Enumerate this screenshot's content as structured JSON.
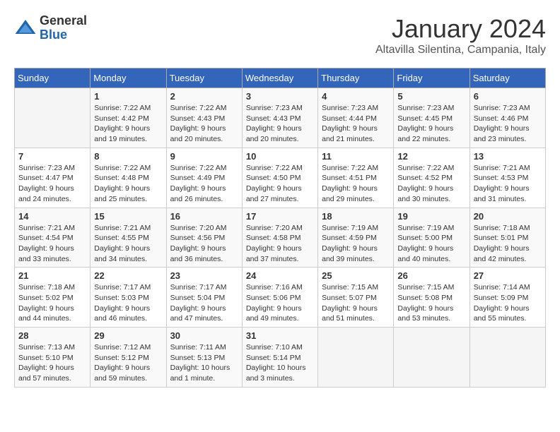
{
  "logo": {
    "general": "General",
    "blue": "Blue"
  },
  "header": {
    "month": "January 2024",
    "location": "Altavilla Silentina, Campania, Italy"
  },
  "weekdays": [
    "Sunday",
    "Monday",
    "Tuesday",
    "Wednesday",
    "Thursday",
    "Friday",
    "Saturday"
  ],
  "weeks": [
    [
      {
        "day": "",
        "info": ""
      },
      {
        "day": "1",
        "info": "Sunrise: 7:22 AM\nSunset: 4:42 PM\nDaylight: 9 hours\nand 19 minutes."
      },
      {
        "day": "2",
        "info": "Sunrise: 7:22 AM\nSunset: 4:43 PM\nDaylight: 9 hours\nand 20 minutes."
      },
      {
        "day": "3",
        "info": "Sunrise: 7:23 AM\nSunset: 4:43 PM\nDaylight: 9 hours\nand 20 minutes."
      },
      {
        "day": "4",
        "info": "Sunrise: 7:23 AM\nSunset: 4:44 PM\nDaylight: 9 hours\nand 21 minutes."
      },
      {
        "day": "5",
        "info": "Sunrise: 7:23 AM\nSunset: 4:45 PM\nDaylight: 9 hours\nand 22 minutes."
      },
      {
        "day": "6",
        "info": "Sunrise: 7:23 AM\nSunset: 4:46 PM\nDaylight: 9 hours\nand 23 minutes."
      }
    ],
    [
      {
        "day": "7",
        "info": "Sunrise: 7:23 AM\nSunset: 4:47 PM\nDaylight: 9 hours\nand 24 minutes."
      },
      {
        "day": "8",
        "info": "Sunrise: 7:22 AM\nSunset: 4:48 PM\nDaylight: 9 hours\nand 25 minutes."
      },
      {
        "day": "9",
        "info": "Sunrise: 7:22 AM\nSunset: 4:49 PM\nDaylight: 9 hours\nand 26 minutes."
      },
      {
        "day": "10",
        "info": "Sunrise: 7:22 AM\nSunset: 4:50 PM\nDaylight: 9 hours\nand 27 minutes."
      },
      {
        "day": "11",
        "info": "Sunrise: 7:22 AM\nSunset: 4:51 PM\nDaylight: 9 hours\nand 29 minutes."
      },
      {
        "day": "12",
        "info": "Sunrise: 7:22 AM\nSunset: 4:52 PM\nDaylight: 9 hours\nand 30 minutes."
      },
      {
        "day": "13",
        "info": "Sunrise: 7:21 AM\nSunset: 4:53 PM\nDaylight: 9 hours\nand 31 minutes."
      }
    ],
    [
      {
        "day": "14",
        "info": "Sunrise: 7:21 AM\nSunset: 4:54 PM\nDaylight: 9 hours\nand 33 minutes."
      },
      {
        "day": "15",
        "info": "Sunrise: 7:21 AM\nSunset: 4:55 PM\nDaylight: 9 hours\nand 34 minutes."
      },
      {
        "day": "16",
        "info": "Sunrise: 7:20 AM\nSunset: 4:56 PM\nDaylight: 9 hours\nand 36 minutes."
      },
      {
        "day": "17",
        "info": "Sunrise: 7:20 AM\nSunset: 4:58 PM\nDaylight: 9 hours\nand 37 minutes."
      },
      {
        "day": "18",
        "info": "Sunrise: 7:19 AM\nSunset: 4:59 PM\nDaylight: 9 hours\nand 39 minutes."
      },
      {
        "day": "19",
        "info": "Sunrise: 7:19 AM\nSunset: 5:00 PM\nDaylight: 9 hours\nand 40 minutes."
      },
      {
        "day": "20",
        "info": "Sunrise: 7:18 AM\nSunset: 5:01 PM\nDaylight: 9 hours\nand 42 minutes."
      }
    ],
    [
      {
        "day": "21",
        "info": "Sunrise: 7:18 AM\nSunset: 5:02 PM\nDaylight: 9 hours\nand 44 minutes."
      },
      {
        "day": "22",
        "info": "Sunrise: 7:17 AM\nSunset: 5:03 PM\nDaylight: 9 hours\nand 46 minutes."
      },
      {
        "day": "23",
        "info": "Sunrise: 7:17 AM\nSunset: 5:04 PM\nDaylight: 9 hours\nand 47 minutes."
      },
      {
        "day": "24",
        "info": "Sunrise: 7:16 AM\nSunset: 5:06 PM\nDaylight: 9 hours\nand 49 minutes."
      },
      {
        "day": "25",
        "info": "Sunrise: 7:15 AM\nSunset: 5:07 PM\nDaylight: 9 hours\nand 51 minutes."
      },
      {
        "day": "26",
        "info": "Sunrise: 7:15 AM\nSunset: 5:08 PM\nDaylight: 9 hours\nand 53 minutes."
      },
      {
        "day": "27",
        "info": "Sunrise: 7:14 AM\nSunset: 5:09 PM\nDaylight: 9 hours\nand 55 minutes."
      }
    ],
    [
      {
        "day": "28",
        "info": "Sunrise: 7:13 AM\nSunset: 5:10 PM\nDaylight: 9 hours\nand 57 minutes."
      },
      {
        "day": "29",
        "info": "Sunrise: 7:12 AM\nSunset: 5:12 PM\nDaylight: 9 hours\nand 59 minutes."
      },
      {
        "day": "30",
        "info": "Sunrise: 7:11 AM\nSunset: 5:13 PM\nDaylight: 10 hours\nand 1 minute."
      },
      {
        "day": "31",
        "info": "Sunrise: 7:10 AM\nSunset: 5:14 PM\nDaylight: 10 hours\nand 3 minutes."
      },
      {
        "day": "",
        "info": ""
      },
      {
        "day": "",
        "info": ""
      },
      {
        "day": "",
        "info": ""
      }
    ]
  ]
}
